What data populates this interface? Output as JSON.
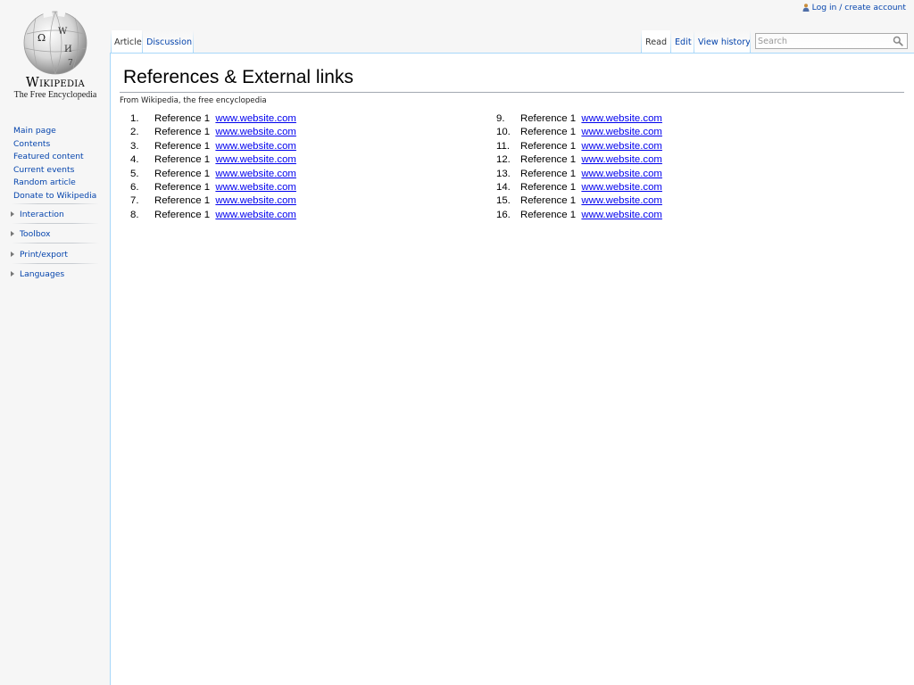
{
  "personal": {
    "login_label": "Log in / create account"
  },
  "logo": {
    "wordmark": "Wikipedia",
    "tagline": "The Free Encyclopedia",
    "globe_glyphs": [
      "Ω",
      "W",
      "И",
      "7"
    ]
  },
  "sidebar": {
    "main_links": [
      "Main page",
      "Contents",
      "Featured content",
      "Current events",
      "Random article",
      "Donate to Wikipedia"
    ],
    "portlets": [
      "Interaction",
      "Toolbox",
      "Print/export",
      "Languages"
    ]
  },
  "tabs": {
    "left": [
      {
        "label": "Article",
        "selected": true
      },
      {
        "label": "Discussion",
        "selected": false
      }
    ],
    "right": [
      {
        "label": "Read",
        "selected": true
      },
      {
        "label": "Edit",
        "selected": false
      },
      {
        "label": "View history",
        "selected": false
      }
    ]
  },
  "search": {
    "placeholder": "Search"
  },
  "article": {
    "title": "References & External links",
    "site_sub": "From Wikipedia, the free encyclopedia",
    "references_left": [
      {
        "num": "1.",
        "label": "Reference 1",
        "link": "www.website.com"
      },
      {
        "num": "2.",
        "label": "Reference 1",
        "link": "www.website.com"
      },
      {
        "num": "3.",
        "label": "Reference 1",
        "link": "www.website.com"
      },
      {
        "num": "4.",
        "label": "Reference 1",
        "link": "www.website.com"
      },
      {
        "num": "5.",
        "label": "Reference 1",
        "link": "www.website.com"
      },
      {
        "num": "6.",
        "label": "Reference 1",
        "link": "www.website.com"
      },
      {
        "num": "7.",
        "label": "Reference 1",
        "link": "www.website.com"
      },
      {
        "num": "8.",
        "label": "Reference 1",
        "link": "www.website.com"
      }
    ],
    "references_right": [
      {
        "num": "9.",
        "label": "Reference 1",
        "link": "www.website.com"
      },
      {
        "num": "10.",
        "label": "Reference 1",
        "link": "www.website.com"
      },
      {
        "num": "11.",
        "label": "Reference 1",
        "link": "www.website.com"
      },
      {
        "num": "12.",
        "label": "Reference 1",
        "link": "www.website.com"
      },
      {
        "num": "13.",
        "label": "Reference 1",
        "link": "www.website.com"
      },
      {
        "num": "14.",
        "label": "Reference 1",
        "link": "www.website.com"
      },
      {
        "num": "15.",
        "label": "Reference 1",
        "link": "www.website.com"
      },
      {
        "num": "16.",
        "label": "Reference 1",
        "link": "www.website.com"
      }
    ]
  },
  "colors": {
    "link": "#0645ad",
    "external_link": "#0000ee",
    "tab_border": "#a7d7f9",
    "sidebar_bg": "#f6f6f6"
  },
  "icons": {
    "user": "user-icon",
    "search": "magnifier-icon",
    "portlet": "triangle-right-icon"
  }
}
